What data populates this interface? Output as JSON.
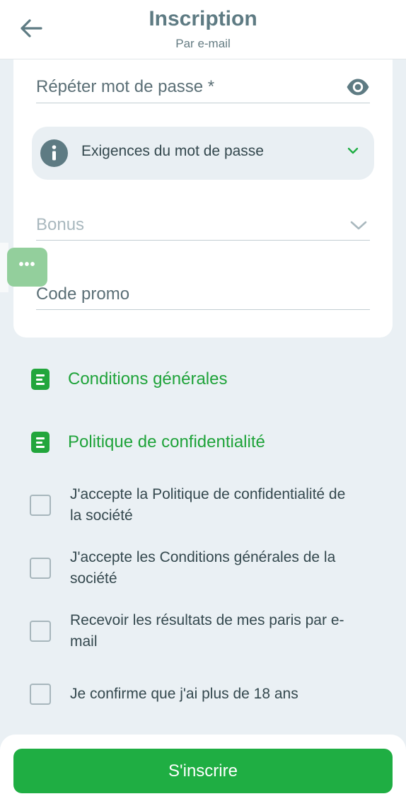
{
  "header": {
    "back_icon": "arrow-left-icon",
    "title": "Inscription",
    "subtitle": "Par e-mail"
  },
  "form": {
    "repeat_password_label": "Répéter mot de passe *",
    "password_toggle_icon": "eye-icon",
    "requirements": {
      "icon": "info-icon",
      "text": "Exigences du mot de passe",
      "chevron": "chevron-down-icon"
    },
    "bonus_label": "Bonus",
    "promo_label": "Code promo"
  },
  "floating_button": {
    "icon": "more-dots-icon",
    "label": "•••"
  },
  "links": [
    {
      "icon": "document-icon",
      "label": "Conditions générales"
    },
    {
      "icon": "document-icon",
      "label": "Politique de confidentialité"
    }
  ],
  "checkboxes": [
    {
      "label": "J'accepte la Politique de confidentialité de la société",
      "checked": false
    },
    {
      "label": "J'accepte les Conditions générales de la société",
      "checked": false
    },
    {
      "label": "Recevoir les résultats de mes paris par e-mail",
      "checked": false
    },
    {
      "label": "Je confirme que j'ai plus de 18 ans",
      "checked": false
    }
  ],
  "submit": {
    "label": "S'inscrire"
  },
  "colors": {
    "accent_green": "#1fae43",
    "header_text": "#5e7b83",
    "background": "#eaf0f4"
  }
}
